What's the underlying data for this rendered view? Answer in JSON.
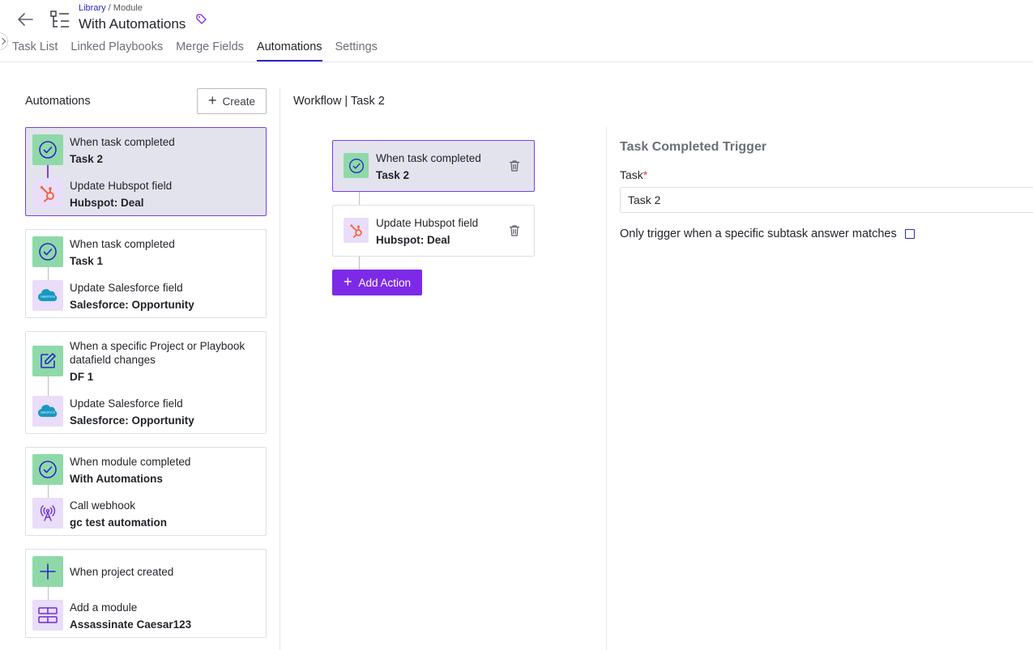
{
  "header": {
    "breadcrumb_link": "Library",
    "breadcrumb_rest": " / Module",
    "title": "With Automations",
    "tabs": [
      {
        "label": "Task List",
        "active": false
      },
      {
        "label": "Linked Playbooks",
        "active": false
      },
      {
        "label": "Merge Fields",
        "active": false
      },
      {
        "label": "Automations",
        "active": true
      },
      {
        "label": "Settings",
        "active": false
      }
    ]
  },
  "automations_panel": {
    "title": "Automations",
    "create_label": "Create",
    "cards": [
      {
        "selected": true,
        "trigger": {
          "icon": "check-circle-icon",
          "title": "When task completed",
          "sub": "Task 2"
        },
        "action": {
          "icon": "hubspot-icon",
          "title": "Update Hubspot field",
          "sub": "Hubspot: Deal"
        }
      },
      {
        "selected": false,
        "trigger": {
          "icon": "check-circle-icon",
          "title": "When task completed",
          "sub": "Task 1"
        },
        "action": {
          "icon": "salesforce-icon",
          "title": "Update Salesforce field",
          "sub": "Salesforce: Opportunity"
        }
      },
      {
        "selected": false,
        "trigger": {
          "icon": "edit-icon",
          "title": "When a specific Project or Playbook datafield changes",
          "sub": "DF 1"
        },
        "action": {
          "icon": "salesforce-icon",
          "title": "Update Salesforce field",
          "sub": "Salesforce: Opportunity"
        }
      },
      {
        "selected": false,
        "trigger": {
          "icon": "check-circle-icon",
          "title": "When module completed",
          "sub": "With Automations"
        },
        "action": {
          "icon": "webhook-antenna-icon",
          "title": "Call webhook",
          "sub": "gc test automation"
        }
      },
      {
        "selected": false,
        "trigger": {
          "icon": "plus-icon",
          "title": "When project created",
          "sub": ""
        },
        "action": {
          "icon": "module-layout-icon",
          "title": "Add a module",
          "sub": "Assassinate Caesar123"
        }
      }
    ]
  },
  "workflow": {
    "title": "Workflow | Task 2",
    "trigger": {
      "title": "When task completed",
      "sub": "Task 2"
    },
    "action": {
      "title": "Update Hubspot field",
      "sub": "Hubspot: Deal"
    },
    "add_action_label": "Add Action"
  },
  "trigger_form": {
    "title": "Task Completed Trigger",
    "task_label": "Task",
    "required_mark": "*",
    "task_value": "Task 2",
    "subtask_label": "Only trigger when a specific subtask answer matches",
    "subtask_checked": false
  },
  "colors": {
    "accent": "#7d2ae8",
    "link": "#2b27c9",
    "trigger_icon_bg": "#8fd9a8",
    "action_icon_bg": "#e9ddf9",
    "selected_bg": "#e3e3ee"
  }
}
